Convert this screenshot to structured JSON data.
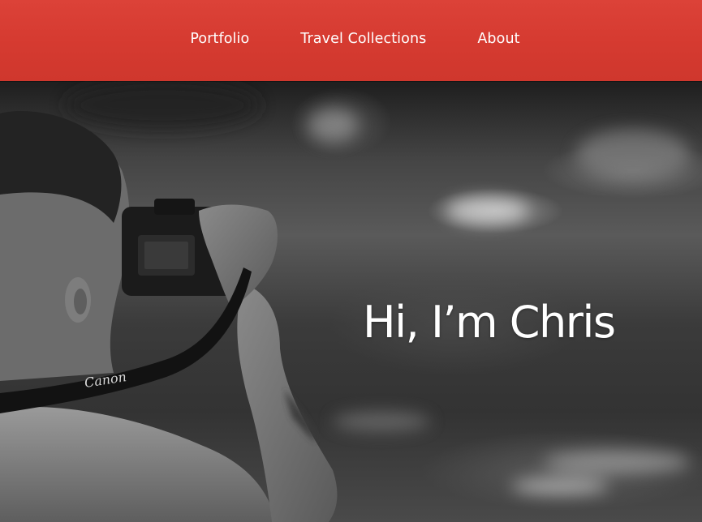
{
  "nav": {
    "items": [
      {
        "label": "Portfolio"
      },
      {
        "label": "Travel Collections"
      },
      {
        "label": "About"
      }
    ],
    "background_color": "#d53a30",
    "text_color": "#ffffff"
  },
  "hero": {
    "heading": "Hi, I’m Chris",
    "camera_brand": "Canon",
    "photo_description_icon": "photographer-with-camera-image"
  }
}
